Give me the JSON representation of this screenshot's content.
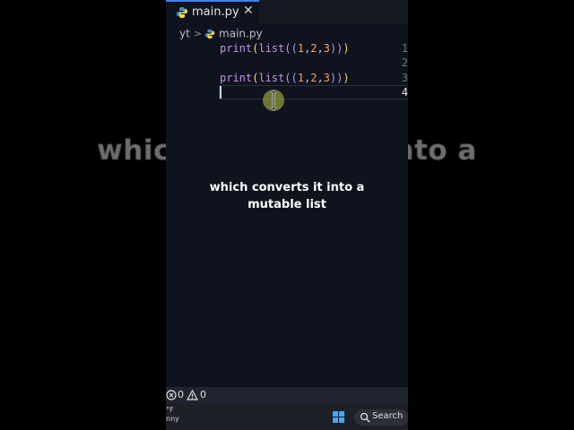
{
  "background_caption": "which converts it into a",
  "tab": {
    "label": "main.py",
    "close_glyph": "✕",
    "icon": "python-icon"
  },
  "breadcrumb": {
    "folder": "yt",
    "separator": ">",
    "file": "main.py"
  },
  "editor": {
    "line_numbers": [
      "1",
      "2",
      "3",
      "4"
    ],
    "active_line": "4",
    "lines": [
      {
        "fn": "print",
        "open1": "(",
        "fn2": "list",
        "open2": "(",
        "open3": "(",
        "n1": "1",
        "c1": ",",
        "n2": "2",
        "c2": ",",
        "n3": "3",
        "close3": ")",
        "close2": ")",
        "close1": ")"
      },
      null,
      {
        "fn": "print",
        "open1": "(",
        "fn2": "list",
        "open2": "(",
        "open3": "(",
        "n1": "1",
        "c1": ",",
        "n2": "2",
        "c2": ",",
        "n3": "3",
        "close3": ")",
        "close2": ")",
        "close1": ")"
      }
    ]
  },
  "caption": {
    "line1": "which converts it into a",
    "line2": "mutable list"
  },
  "statusbar": {
    "errors": "0",
    "warnings": "0"
  },
  "taskbar": {
    "weather_line1": "°F",
    "weather_line2": "nny",
    "search_label": "Search"
  },
  "colors": {
    "accent": "#3b82f6",
    "editor_bg": "#0f131d",
    "function": "#c792ea",
    "number": "#ff9e64"
  }
}
